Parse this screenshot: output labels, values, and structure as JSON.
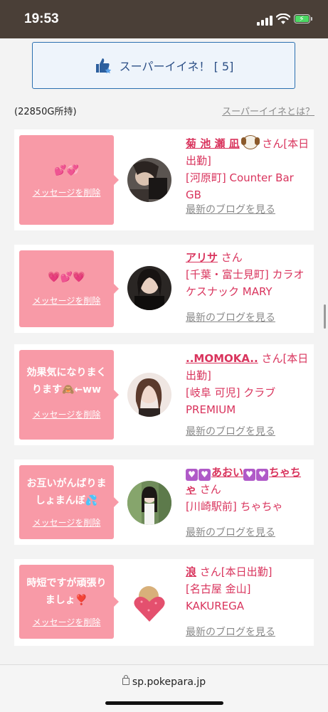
{
  "status_bar": {
    "time": "19:53"
  },
  "super_like": {
    "button_label": "スーパーイイネ！ [ 5]"
  },
  "meta": {
    "gold": "(22850G所持)",
    "about_link": "スーパーイイネとは？"
  },
  "delete_label": "メッセージを削除",
  "blog_label": "最新のブログを見る",
  "cards": [
    {
      "message": "💕💞",
      "name": "菊 池  瀬 凪",
      "suffix": "さん[本日出勤]",
      "shop": "[河原町] Counter Bar GB"
    },
    {
      "message": "💗💕💗",
      "name": "アリサ",
      "suffix": "さん",
      "shop": "[千葉・富士見町] カラオケスナック MARY"
    },
    {
      "message": "効果気になりまくります🙈←ww",
      "name": "..MOMOKA..",
      "suffix": "さん[本日出勤]",
      "shop": "[岐阜 可児] クラブPREMIUM"
    },
    {
      "message": "お互いがんばりましょまんぼ💦",
      "name": "あおい",
      "name_tail": "ちゃちゃ",
      "suffix": "さん",
      "shop": "[川崎駅前] ちゃちゃ"
    },
    {
      "message": "時短ですが頑張りましょ❣️",
      "name": "浪",
      "suffix": "さん[本日出勤]",
      "shop": "[名古屋 金山] KAKUREGA"
    }
  ],
  "url_bar": {
    "url": "sp.pokepara.jp"
  },
  "colors": {
    "accent": "#d9345d",
    "bubble": "#f89aa7",
    "button_border": "#2a6fb0"
  }
}
